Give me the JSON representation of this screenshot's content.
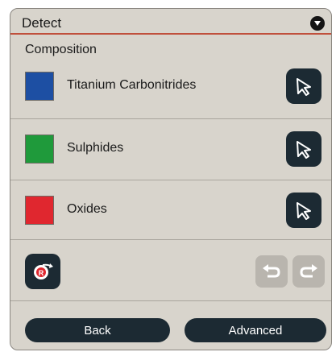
{
  "header": {
    "title": "Detect"
  },
  "section": {
    "label": "Composition"
  },
  "phases": [
    {
      "label": "Titanium Carbonitrides",
      "color": "#1d4fa3"
    },
    {
      "label": "Sulphides",
      "color": "#1f9a3b"
    },
    {
      "label": "Oxides",
      "color": "#e0272f"
    }
  ],
  "footer": {
    "back_label": "Back",
    "advanced_label": "Advanced"
  }
}
